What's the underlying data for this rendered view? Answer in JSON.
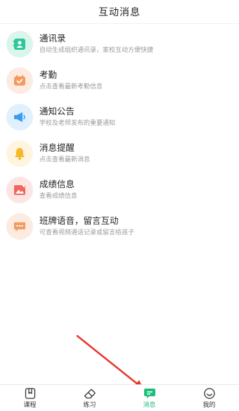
{
  "header": {
    "title": "互动消息"
  },
  "items": [
    {
      "title": "通讯录",
      "subtitle": "自动生成组织通讯录，家校互动方便快捷",
      "icon": "contacts-icon",
      "bg": "#d9f5ec",
      "color": "#2ec79a"
    },
    {
      "title": "考勤",
      "subtitle": "点击查看最新考勤信息",
      "icon": "calendar-icon",
      "bg": "#fdebe1",
      "color": "#f39a5d"
    },
    {
      "title": "通知公告",
      "subtitle": "学校及老师发布的重要通知",
      "icon": "megaphone-icon",
      "bg": "#e1f0fd",
      "color": "#3d9bf0"
    },
    {
      "title": "消息提醒",
      "subtitle": "点击查看最新消息",
      "icon": "bell-icon",
      "bg": "#fff5df",
      "color": "#f7b82c"
    },
    {
      "title": "成绩信息",
      "subtitle": "查看成绩信息",
      "icon": "picture-icon",
      "bg": "#fde5e3",
      "color": "#f0675c"
    },
    {
      "title": "班牌语音，留言互动",
      "subtitle": "可查看视频通话记录或留言给孩子",
      "icon": "chat-bubble-icon",
      "bg": "#fdebe1",
      "color": "#f39a5d"
    }
  ],
  "tabbar": {
    "tabs": [
      {
        "label": "课程",
        "icon": "bookmark-icon"
      },
      {
        "label": "练习",
        "icon": "eraser-icon"
      },
      {
        "label": "消息",
        "icon": "message-icon",
        "active": true
      },
      {
        "label": "我的",
        "icon": "smile-icon"
      }
    ],
    "active_color": "#1fbf79"
  },
  "annotation": {
    "arrow_color": "#e8352b"
  }
}
